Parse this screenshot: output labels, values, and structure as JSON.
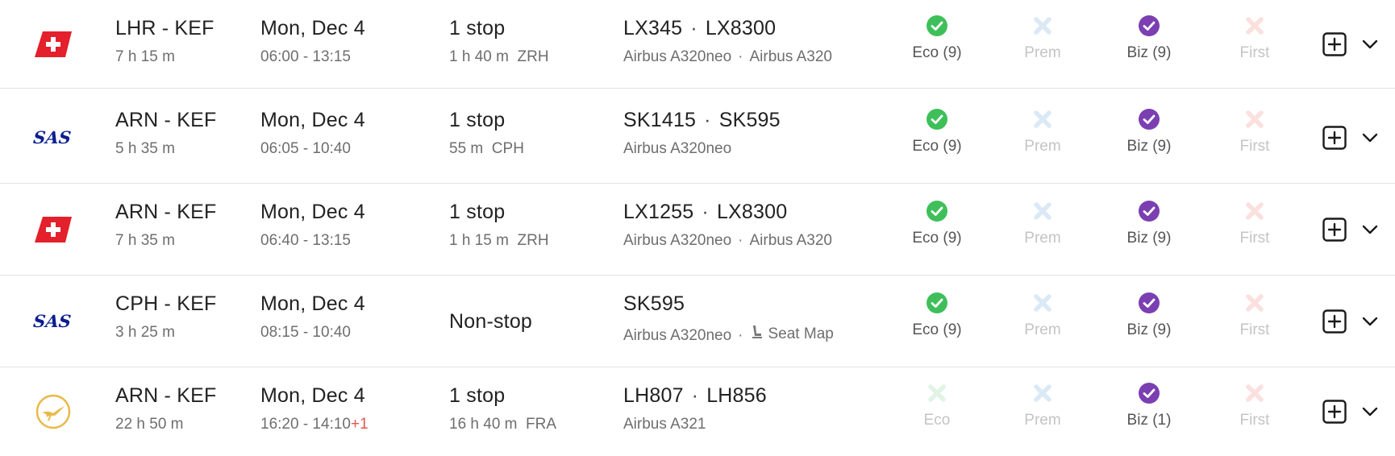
{
  "colors": {
    "eco_available": "#3fbf5a",
    "biz_available": "#7b3fb2",
    "prem_unavailable": "#dbe9f6",
    "first_unavailable": "#fbe0de",
    "eco_unavailable": "#e0f3e4",
    "plus_day": "#e2574c",
    "swiss_red": "#e3202b",
    "sas_blue": "#0a1f8f",
    "lufthansa_yellow": "#e9b949"
  },
  "flights": [
    {
      "airline_logo": "swiss-logo",
      "route": "LHR - KEF",
      "duration": "7 h 15 m",
      "date": "Mon, Dec 4",
      "times": "06:00 - 13:15",
      "plus_day": "",
      "stops": "1 stop",
      "layover": "1 h 40 m  ZRH",
      "flights": [
        "LX345",
        "LX8300"
      ],
      "aircraft": [
        "Airbus A320neo",
        "Airbus A320"
      ],
      "seat_map": "",
      "cabins": {
        "eco": {
          "label": "Eco (9)",
          "available": true
        },
        "prem": {
          "label": "Prem",
          "available": false
        },
        "biz": {
          "label": "Biz (9)",
          "available": true
        },
        "first": {
          "label": "First",
          "available": false
        }
      }
    },
    {
      "airline_logo": "sas-logo",
      "route": "ARN - KEF",
      "duration": "5 h 35 m",
      "date": "Mon, Dec 4",
      "times": "06:05 - 10:40",
      "plus_day": "",
      "stops": "1 stop",
      "layover": "55 m  CPH",
      "flights": [
        "SK1415",
        "SK595"
      ],
      "aircraft": [
        "Airbus A320neo"
      ],
      "seat_map": "",
      "cabins": {
        "eco": {
          "label": "Eco (9)",
          "available": true
        },
        "prem": {
          "label": "Prem",
          "available": false
        },
        "biz": {
          "label": "Biz (9)",
          "available": true
        },
        "first": {
          "label": "First",
          "available": false
        }
      }
    },
    {
      "airline_logo": "swiss-logo",
      "route": "ARN - KEF",
      "duration": "7 h 35 m",
      "date": "Mon, Dec 4",
      "times": "06:40 - 13:15",
      "plus_day": "",
      "stops": "1 stop",
      "layover": "1 h 15 m  ZRH",
      "flights": [
        "LX1255",
        "LX8300"
      ],
      "aircraft": [
        "Airbus A320neo",
        "Airbus A320"
      ],
      "seat_map": "",
      "cabins": {
        "eco": {
          "label": "Eco (9)",
          "available": true
        },
        "prem": {
          "label": "Prem",
          "available": false
        },
        "biz": {
          "label": "Biz (9)",
          "available": true
        },
        "first": {
          "label": "First",
          "available": false
        }
      }
    },
    {
      "airline_logo": "sas-logo",
      "route": "CPH - KEF",
      "duration": "3 h 25 m",
      "date": "Mon, Dec 4",
      "times": "08:15 - 10:40",
      "plus_day": "",
      "stops": "Non-stop",
      "layover": "",
      "flights": [
        "SK595"
      ],
      "aircraft": [
        "Airbus A320neo"
      ],
      "seat_map": "Seat Map",
      "cabins": {
        "eco": {
          "label": "Eco (9)",
          "available": true
        },
        "prem": {
          "label": "Prem",
          "available": false
        },
        "biz": {
          "label": "Biz (9)",
          "available": true
        },
        "first": {
          "label": "First",
          "available": false
        }
      }
    },
    {
      "airline_logo": "lufthansa-logo",
      "route": "ARN - KEF",
      "duration": "22 h 50 m",
      "date": "Mon, Dec 4",
      "times": "16:20 - 14:10",
      "plus_day": "+1",
      "stops": "1 stop",
      "layover": "16 h 40 m  FRA",
      "flights": [
        "LH807",
        "LH856"
      ],
      "aircraft": [
        "Airbus A321"
      ],
      "seat_map": "",
      "cabins": {
        "eco": {
          "label": "Eco",
          "available": false
        },
        "prem": {
          "label": "Prem",
          "available": false
        },
        "biz": {
          "label": "Biz (1)",
          "available": true
        },
        "first": {
          "label": "First",
          "available": false
        }
      }
    }
  ]
}
